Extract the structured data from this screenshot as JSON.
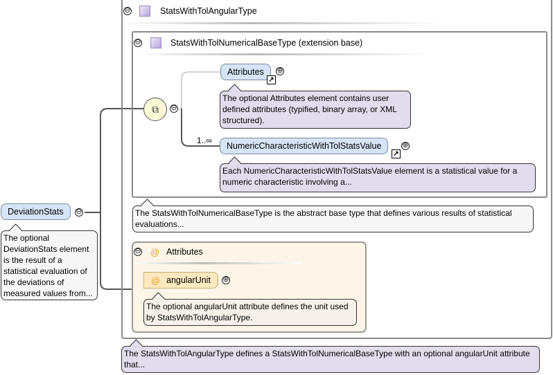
{
  "root_element": {
    "name": "DeviationStats",
    "doc": "The optional DeviationStats element is the result of a statistical evaluation of the deviations of measured values from..."
  },
  "type": {
    "title": "StatsWithTolAngularType",
    "doc": "The StatsWithTolAngularType defines a StatsWithTolNumericalBaseType with an optional angularUnit attribute that..."
  },
  "base_type": {
    "title": "StatsWithTolNumericalBaseType (extension base)",
    "doc": "The StatsWithTolNumericalBaseType is the abstract base type that defines various results of statistical evaluations..."
  },
  "sequence": {
    "children": [
      {
        "name": "Attributes",
        "cardinality": "",
        "doc": "The optional Attributes element contains user defined attributes (typified, binary array, or XML structured)."
      },
      {
        "name": "NumericCharacteristicWithTolStatsValue",
        "cardinality": "1..∞",
        "doc": "Each NumericCharacteristicWithTolStatsValue element is a statistical value for a numeric characteristic involving a..."
      }
    ]
  },
  "attributes_group": {
    "title": "Attributes",
    "at_symbol": "@",
    "attribute": {
      "name": "angularUnit",
      "doc": "The optional angularUnit attribute defines the unit used by StatsWithTolAngularType."
    }
  },
  "icons": {
    "collapse": "⊖",
    "expand": "⊕",
    "link": "↗"
  },
  "colors": {
    "element_fill": "#d6e4f7",
    "doc_fill": "#e2dcec",
    "attribute_fill": "#fde9c0",
    "group_fill": "#fdf6e8"
  }
}
